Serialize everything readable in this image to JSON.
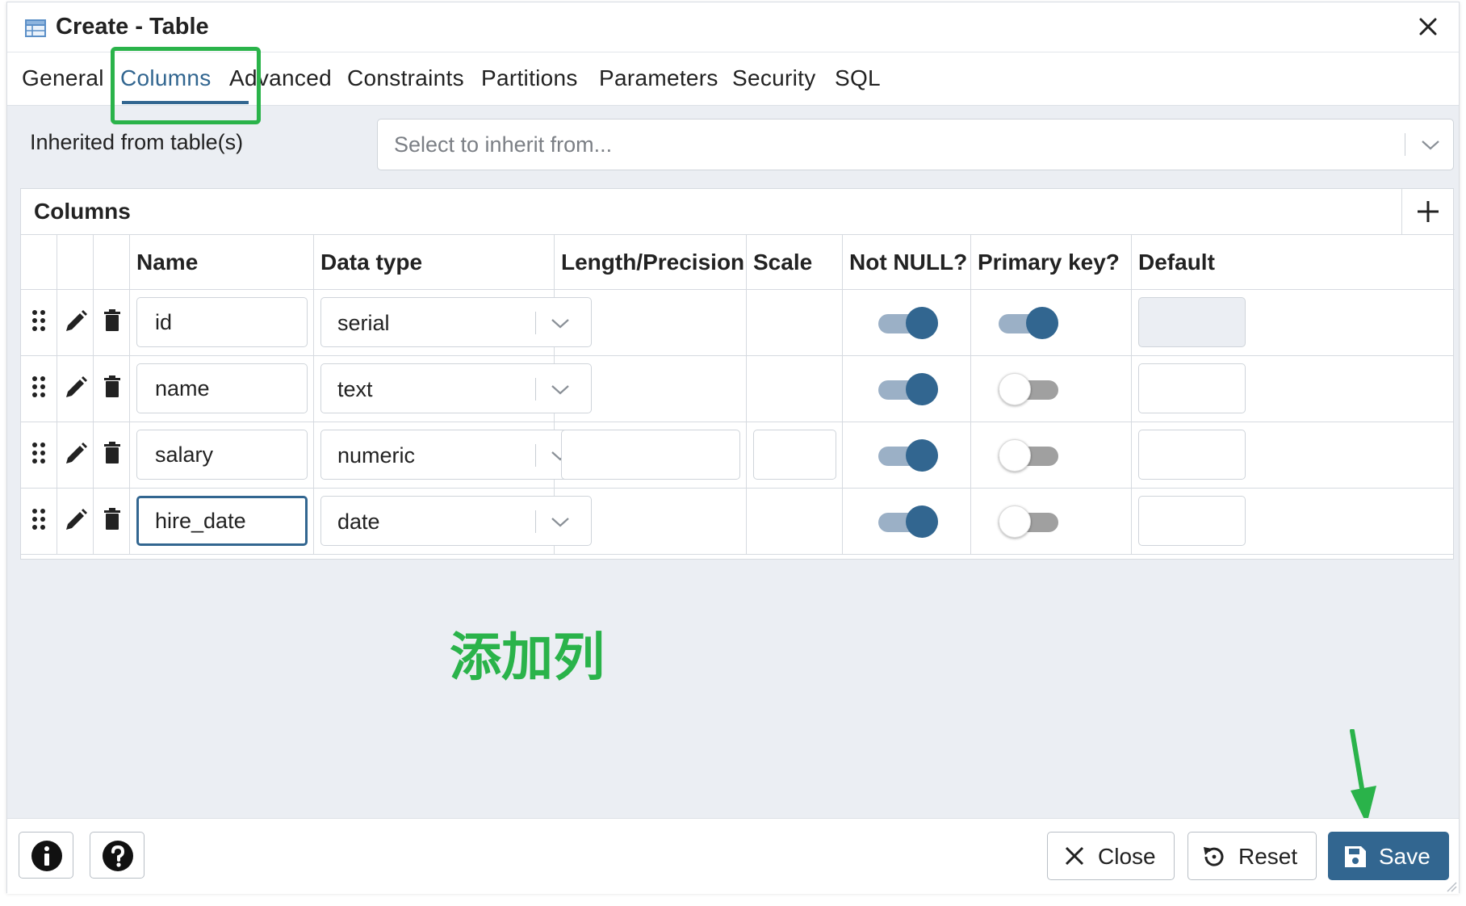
{
  "dialog": {
    "title": "Create - Table",
    "icon": "table-icon"
  },
  "tabs": [
    {
      "label": "General"
    },
    {
      "label": "Columns",
      "active": true
    },
    {
      "label": "Advanced"
    },
    {
      "label": "Constraints"
    },
    {
      "label": "Partitions"
    },
    {
      "label": "Parameters"
    },
    {
      "label": "Security"
    },
    {
      "label": "SQL"
    }
  ],
  "inherit": {
    "label": "Inherited from table(s)",
    "placeholder": "Select to inherit from..."
  },
  "columns_grid": {
    "title": "Columns",
    "headers": [
      "Name",
      "Data type",
      "Length/Precision",
      "Scale",
      "Not NULL?",
      "Primary key?",
      "Default"
    ],
    "rows": [
      {
        "name": "id",
        "data_type": "serial",
        "not_null": true,
        "primary_key": true
      },
      {
        "name": "name",
        "data_type": "text",
        "not_null": true,
        "primary_key": false
      },
      {
        "name": "salary",
        "data_type": "numeric",
        "not_null": true,
        "primary_key": false
      },
      {
        "name": "hire_date",
        "data_type": "date",
        "not_null": true,
        "primary_key": false
      }
    ]
  },
  "annotation": {
    "text": "添加列",
    "color": "#2ab34a"
  },
  "footer": {
    "info_icon": "info-icon",
    "help_icon": "help-icon",
    "close_label": "Close",
    "reset_label": "Reset",
    "save_label": "Save"
  },
  "colors": {
    "accent": "#326690",
    "highlight": "#2ab34a"
  }
}
